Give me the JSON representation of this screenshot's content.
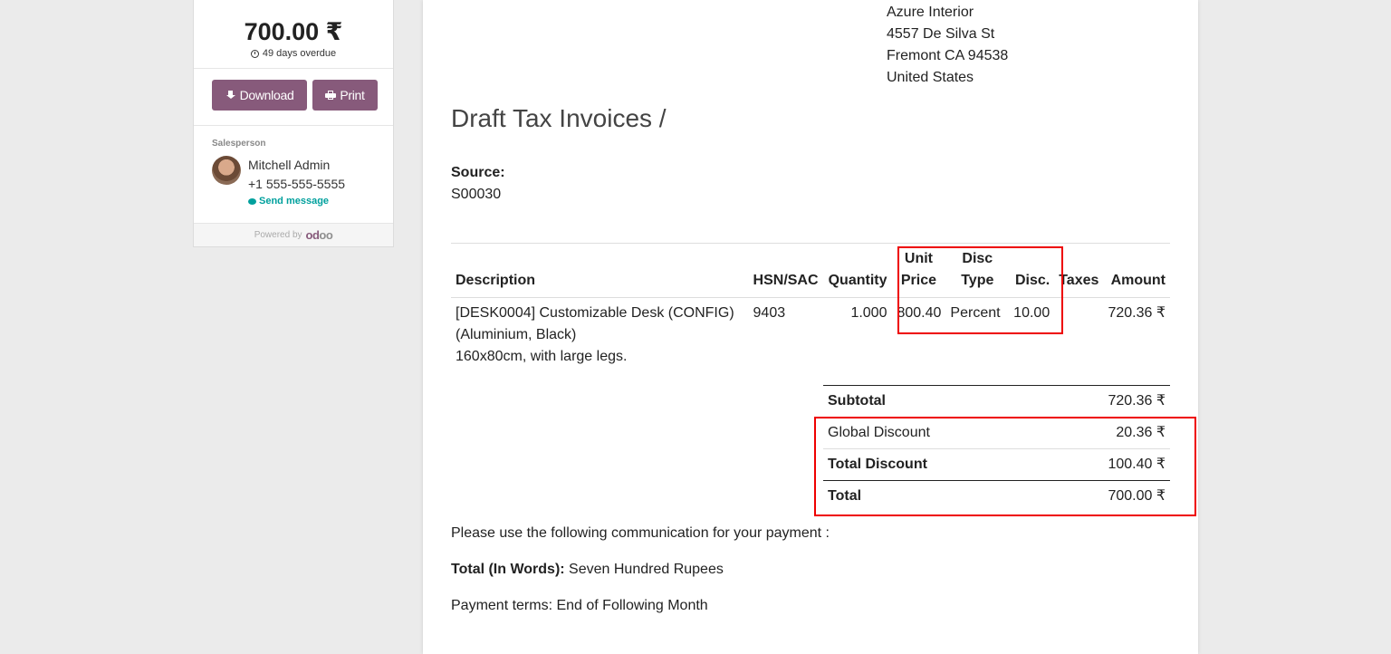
{
  "sidebar": {
    "amount": "700.00 ₹",
    "overdue": "49 days overdue",
    "download_label": "Download",
    "print_label": "Print",
    "salesperson_label": "Salesperson",
    "salesperson_name": "Mitchell Admin",
    "salesperson_phone": "+1 555-555-5555",
    "send_message_label": "Send message",
    "powered_by": "Powered by",
    "brand_prefix": "od",
    "brand_suffix": "oo"
  },
  "document": {
    "address": [
      "Azure Interior",
      "4557 De Silva St",
      "Fremont CA 94538",
      "United States"
    ],
    "title": "Draft Tax Invoices /",
    "source_label": "Source:",
    "source_value": "S00030",
    "columns": {
      "description": "Description",
      "hsn": "HSN/SAC",
      "quantity": "Quantity",
      "unit_price_1": "Unit",
      "unit_price_2": "Price",
      "disc_type_1": "Disc",
      "disc_type_2": "Type",
      "disc": "Disc.",
      "taxes": "Taxes",
      "amount": "Amount"
    },
    "lines": [
      {
        "description_1": "[DESK0004] Customizable Desk (CONFIG)",
        "description_2": "(Aluminium, Black)",
        "description_3": "160x80cm, with large legs.",
        "hsn": "9403",
        "quantity": "1.000",
        "unit_price": "800.40",
        "disc_type": "Percent",
        "disc": "10.00",
        "taxes": "",
        "amount": "720.36 ₹"
      }
    ],
    "totals": {
      "subtotal_label": "Subtotal",
      "subtotal_value": "720.36 ₹",
      "global_discount_label": "Global Discount",
      "global_discount_value": "20.36 ₹",
      "total_discount_label": "Total Discount",
      "total_discount_value": "100.40 ₹",
      "total_label": "Total",
      "total_value": "700.00 ₹"
    },
    "payment_communication": "Please use the following communication for your payment :",
    "total_in_words_label": "Total (In Words):",
    "total_in_words_value": " Seven Hundred Rupees",
    "payment_terms": "Payment terms: End of Following Month"
  },
  "colors": {
    "primary_button": "#875a7b",
    "link_teal": "#00a09d",
    "highlight_box": "#ee0000"
  }
}
